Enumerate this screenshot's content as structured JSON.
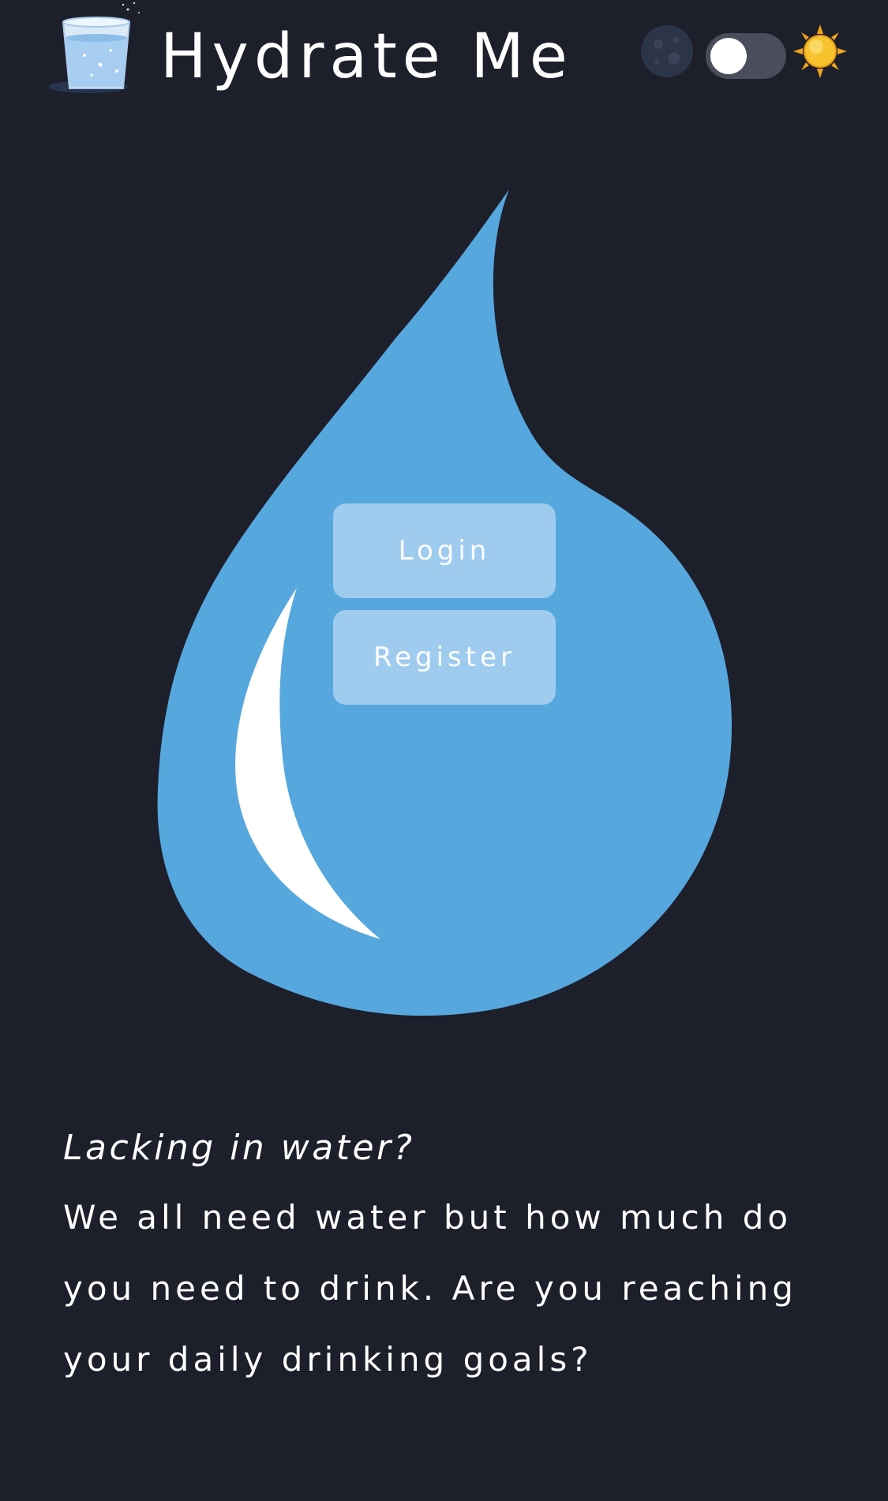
{
  "header": {
    "app_title": "Hydrate Me",
    "logo_icon": "water-glass-icon",
    "theme": {
      "moon_icon": "moon-icon",
      "sun_icon": "sun-icon",
      "mode": "dark"
    }
  },
  "hero": {
    "drop_icon": "water-drop-icon",
    "login_label": "Login",
    "register_label": "Register"
  },
  "intro": {
    "heading": "Lacking in water?",
    "body": "We all need water but how much do you need to drink. Are you reaching your daily drinking goals?"
  },
  "colors": {
    "background": "#1d1f2b",
    "drop": "#56a7de",
    "button": "#9ecbee",
    "toggle_track": "#4b4e5a",
    "text": "#ffffff"
  }
}
